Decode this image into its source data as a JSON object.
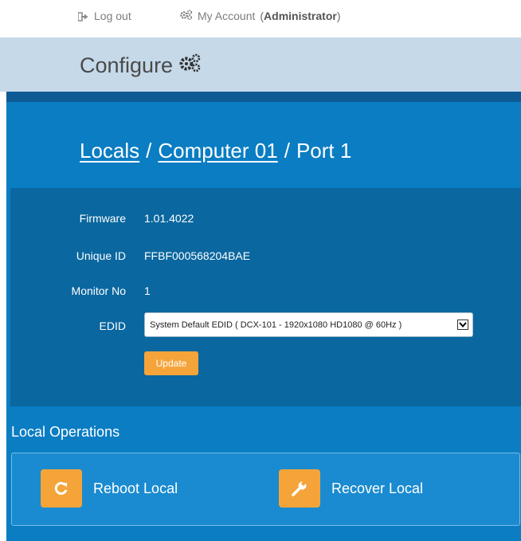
{
  "topbar": {
    "logout_label": "Log out",
    "account_label": "My Account",
    "account_role_open": "(",
    "account_role": "Administrator",
    "account_role_close": ")"
  },
  "header": {
    "title": "Configure"
  },
  "breadcrumb": {
    "crumb1": "Locals",
    "sep1": "/",
    "crumb2": "Computer 01",
    "sep2": "/",
    "current": "Port 1"
  },
  "info": {
    "firmware_label": "Firmware",
    "firmware_value": "1.01.4022",
    "unique_id_label": "Unique ID",
    "unique_id_value": "FFBF000568204BAE",
    "monitor_label": "Monitor No",
    "monitor_value": "1",
    "edid_label": "EDID",
    "edid_selected": "System Default EDID ( DCX-101  - 1920x1080 HD1080 @ 60Hz )",
    "update_label": "Update"
  },
  "operations": {
    "title": "Local Operations",
    "reboot_label": "Reboot Local",
    "recover_label": "Recover Local"
  },
  "colors": {
    "header_band": "#c5d9e9",
    "main_blue": "#0a7dc3",
    "info_box": "#0a679f",
    "accent_orange": "#f5a43a"
  },
  "icons": {
    "logout": "logout-icon",
    "account": "gears-icon",
    "configure": "gears-icon",
    "reboot": "refresh-icon",
    "recover": "wrench-icon",
    "dropdown": "chevron-down-icon"
  }
}
